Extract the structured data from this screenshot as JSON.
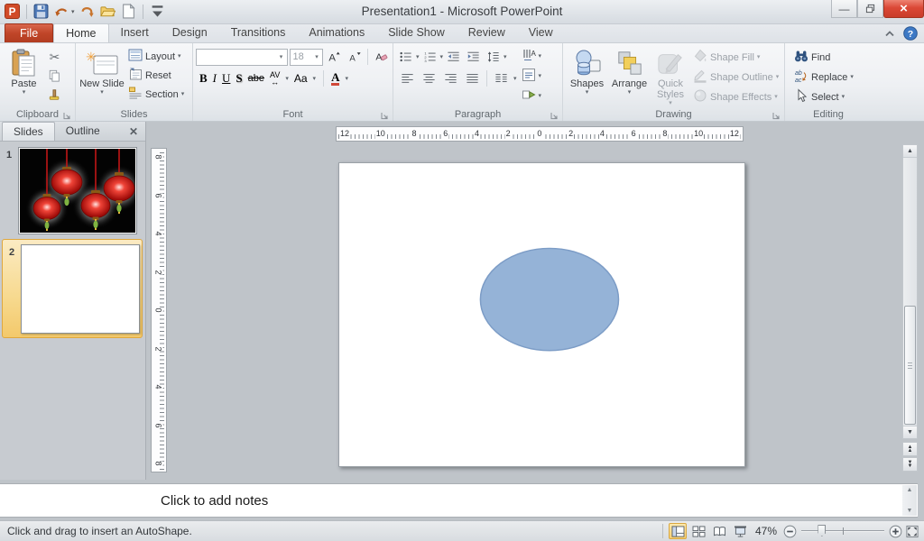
{
  "window": {
    "title": "Presentation1  -  Microsoft PowerPoint"
  },
  "tabs": [
    {
      "label": "File"
    },
    {
      "label": "Home"
    },
    {
      "label": "Insert"
    },
    {
      "label": "Design"
    },
    {
      "label": "Transitions"
    },
    {
      "label": "Animations"
    },
    {
      "label": "Slide Show"
    },
    {
      "label": "Review"
    },
    {
      "label": "View"
    }
  ],
  "ribbon": {
    "clipboard": {
      "label": "Clipboard",
      "paste_label": "Paste"
    },
    "slides": {
      "label": "Slides",
      "new_slide_label": "New Slide",
      "layout_label": "Layout",
      "reset_label": "Reset",
      "section_label": "Section"
    },
    "font": {
      "label": "Font",
      "font_name_value": "",
      "size_value": "18",
      "bold": "B",
      "italic": "I",
      "underline": "U",
      "shadow": "S",
      "strikethrough": "abe",
      "char_spacing": "AV",
      "change_case": "Aa",
      "font_color": "A"
    },
    "paragraph": {
      "label": "Paragraph"
    },
    "drawing": {
      "label": "Drawing",
      "shapes_label": "Shapes",
      "arrange_label": "Arrange",
      "quick_styles_label": "Quick Styles",
      "shape_fill_label": "Shape Fill",
      "shape_outline_label": "Shape Outline",
      "shape_effects_label": "Shape Effects"
    },
    "editing": {
      "label": "Editing",
      "find_label": "Find",
      "replace_label": "Replace",
      "select_label": "Select"
    }
  },
  "slides_panel": {
    "tabs": [
      {
        "label": "Slides"
      },
      {
        "label": "Outline"
      }
    ],
    "slides": [
      {
        "number": "1"
      },
      {
        "number": "2",
        "selected": true
      }
    ]
  },
  "rulers": {
    "horizontal": [
      "12",
      "10",
      "8",
      "6",
      "4",
      "2",
      "0",
      "2",
      "4",
      "6",
      "8",
      "10",
      "12"
    ],
    "vertical": [
      "8",
      "6",
      "4",
      "2",
      "0",
      "2",
      "4",
      "6",
      "8"
    ]
  },
  "slide": {
    "shape": "oval",
    "fill_color": "#95B3D7",
    "outline_color": "#7C9CC6"
  },
  "notes": {
    "placeholder": "Click to add notes"
  },
  "status_bar": {
    "message": "Click and drag to insert an AutoShape.",
    "zoom_level": "47%"
  }
}
